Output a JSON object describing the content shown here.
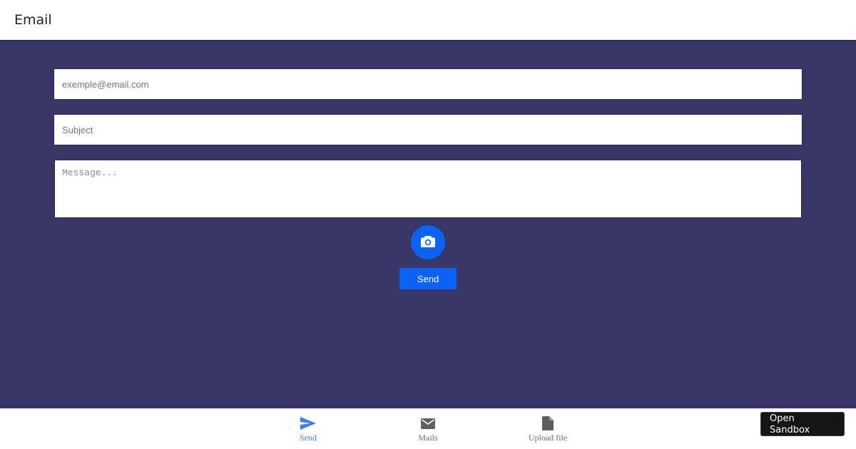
{
  "header": {
    "title": "Email"
  },
  "form": {
    "email_placeholder": "exemple@email.com",
    "email_value": "",
    "subject_placeholder": "Subject",
    "subject_value": "",
    "message_placeholder": "Message...",
    "message_value": "",
    "camera_icon": "camera-icon",
    "send_label": "Send"
  },
  "bottom_nav": {
    "items": [
      {
        "label": "Send",
        "icon": "send-icon",
        "active": true
      },
      {
        "label": "Mails",
        "icon": "mail-icon",
        "active": false
      },
      {
        "label": "Upload file",
        "icon": "file-icon",
        "active": false
      }
    ]
  },
  "sandbox": {
    "label": "Open Sandbox"
  },
  "colors": {
    "background": "#383669",
    "accent": "#0a63f5",
    "active_nav": "#3d7ee8",
    "inactive_nav": "#6b6b6b"
  }
}
